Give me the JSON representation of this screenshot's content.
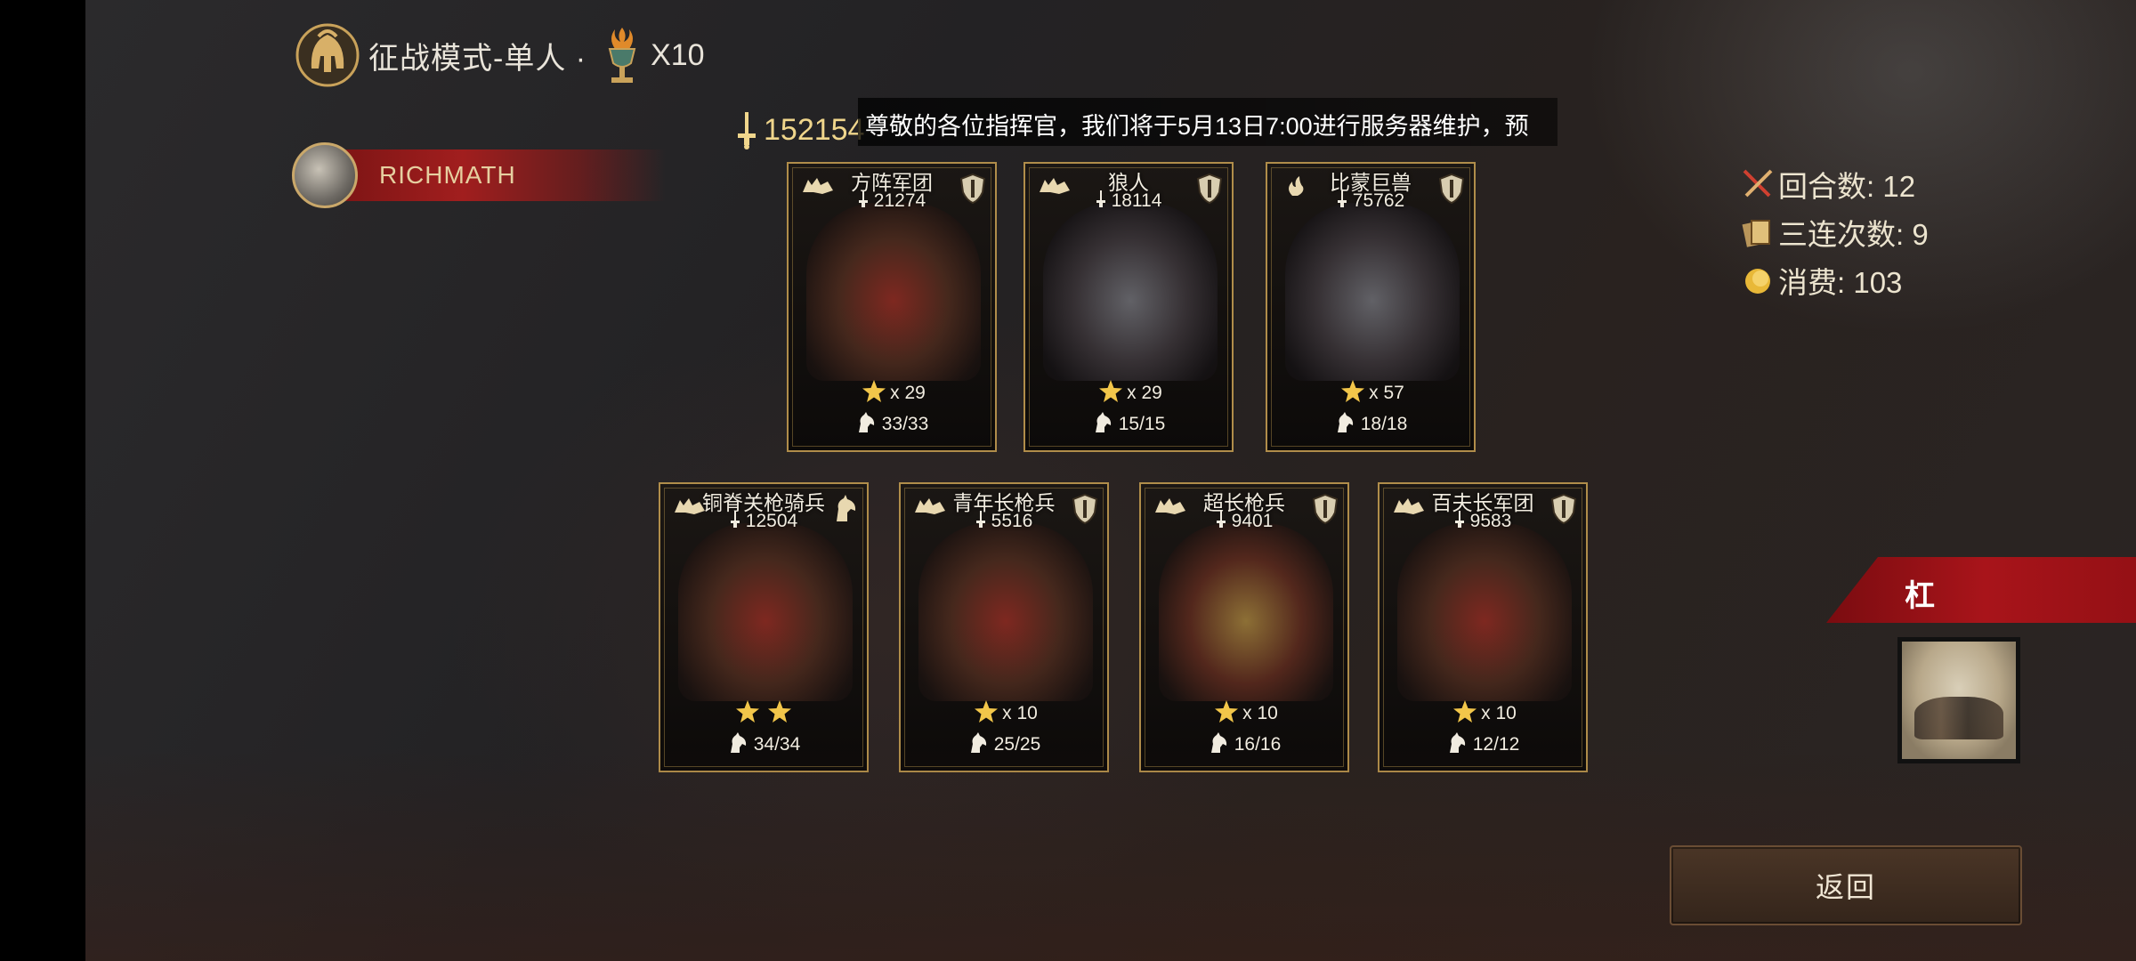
{
  "header": {
    "title": "征战模式-单人 ·",
    "count": "X10"
  },
  "player": {
    "name": "RICHMATH"
  },
  "power": {
    "value": "152154"
  },
  "notice": {
    "text": "尊敬的各位指挥官，我们将于5月13日7:00进行服务器维护，预"
  },
  "stats": {
    "rounds": "回合数: 12",
    "triples": "三连次数: 9",
    "cost": "消费: 103"
  },
  "cards_top": [
    {
      "name": "方阵军团",
      "power": "21274",
      "stars_text": "x 29",
      "troops": "33/33"
    },
    {
      "name": "狼人",
      "power": "18114",
      "stars_text": "x 29",
      "troops": "15/15"
    },
    {
      "name": "比蒙巨兽",
      "power": "75762",
      "stars_text": "x 57",
      "troops": "18/18"
    }
  ],
  "cards_bottom": [
    {
      "name": "铜脊关枪骑兵",
      "power": "12504",
      "stars_text": "",
      "troops": "34/34"
    },
    {
      "name": "青年长枪兵",
      "power": "5516",
      "stars_text": "x 10",
      "troops": "25/25"
    },
    {
      "name": "超长枪兵",
      "power": "9401",
      "stars_text": "x 10",
      "troops": "16/16"
    },
    {
      "name": "百夫长军团",
      "power": "9583",
      "stars_text": "x 10",
      "troops": "12/12"
    }
  ],
  "side": {
    "banner_label": "杠"
  },
  "buttons": {
    "return_label": "返回"
  },
  "colors": {
    "gold": "#b08d4a",
    "red_banner": "#a8141a",
    "power_text": "#f0d68c"
  }
}
